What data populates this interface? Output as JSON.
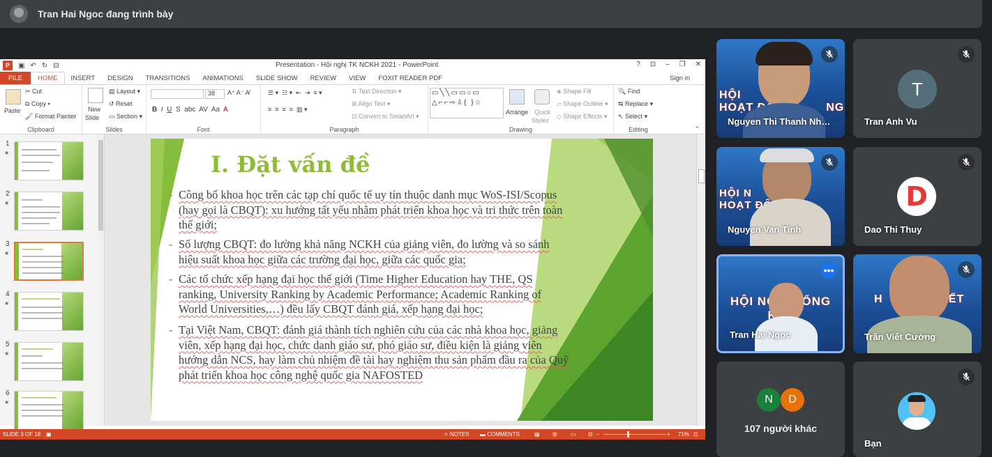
{
  "meet": {
    "presenter_title": "Tran Hai Ngoc đang trình bày",
    "participants": [
      {
        "name": "Nguyen Thi Thanh Nh…",
        "muted": true,
        "type": "video"
      },
      {
        "name": "Tran Anh Vu",
        "muted": true,
        "type": "letter",
        "letter": "T"
      },
      {
        "name": "Nguyen Van Tinh",
        "muted": true,
        "type": "video"
      },
      {
        "name": "Dao Thi Thuy",
        "muted": true,
        "type": "logo",
        "letter": "D"
      },
      {
        "name": "Tran Hai Ngoc",
        "muted": false,
        "type": "video",
        "active": true
      },
      {
        "name": "Trần Viết Cường",
        "muted": true,
        "type": "video"
      },
      {
        "name": "107 người khác",
        "type": "others",
        "letters": [
          "N",
          "D"
        ]
      },
      {
        "name": "Bạn",
        "muted": true,
        "type": "self"
      }
    ],
    "video_banner": "HỘI NGHỊ TỔNG KẾT",
    "colors": {
      "bg": "#202124",
      "tile": "#3c4043",
      "accent": "#8ab4f8",
      "avatar_n": "#188038",
      "avatar_d": "#e8710a"
    }
  },
  "ppt": {
    "window_title": "Presentation - Hội nghị TK NCKH 2021 - PowerPoint",
    "tabs": [
      "FILE",
      "HOME",
      "INSERT",
      "DESIGN",
      "TRANSITIONS",
      "ANIMATIONS",
      "SLIDE SHOW",
      "REVIEW",
      "VIEW",
      "FOXIT READER PDF"
    ],
    "active_tab": "HOME",
    "sign_in": "Sign in",
    "ribbon": {
      "clipboard": {
        "label": "Clipboard",
        "paste": "Paste",
        "cut": "Cut",
        "copy": "Copy",
        "format_painter": "Format Painter"
      },
      "slides": {
        "label": "Slides",
        "new_slide_1": "New",
        "new_slide_2": "Slide",
        "layout": "Layout",
        "reset": "Reset",
        "section": "Section"
      },
      "font": {
        "label": "Font",
        "size": "38"
      },
      "paragraph": {
        "label": "Paragraph",
        "text_direction": "Text Direction",
        "align_text": "Align Text",
        "convert": "Convert to SmartArt"
      },
      "drawing": {
        "label": "Drawing",
        "arrange": "Arrange",
        "quick_styles_1": "Quick",
        "quick_styles_2": "Styles",
        "shape_fill": "Shape Fill",
        "shape_outline": "Shape Outline",
        "shape_effects": "Shape Effects"
      },
      "editing": {
        "label": "Editing",
        "find": "Find",
        "replace": "Replace",
        "select": "Select"
      }
    },
    "thumbnails": [
      "1",
      "2",
      "3",
      "4",
      "5",
      "6"
    ],
    "selected_slide": "3",
    "slide": {
      "title": "I. Đặt vấn đề",
      "bullets": [
        "Công bố khoa học trên các tạp chí quốc tế uy tín thuộc danh mục WoS-ISI/Scopus (hay gọi là CBQT): xu hướng tất yếu nhằm phát triển khoa học và tri thức trên toàn thế giới;",
        "Số lượng CBQT: đo lường khả năng NCKH của giảng viên, đo lường và so sánh hiệu suất khoa học giữa các trường đại học, giữa các quốc gia;",
        "Các tổ chức xếp hạng đại học thế giới (Time Higher Education hay THE, QS ranking, University Ranking by Academic Performance; Academic Ranking of World Universities,…) đều lấy CBQT đánh giá, xếp hạng đại học;",
        "Tại Việt Nam, CBQT: đánh giá thành tích nghiên cứu của các nhà khoa học, giảng viên, xếp hạng đại học, chức danh giáo sư, phó giáo sư, điều kiện là giảng viên hướng dẫn NCS, hay làm chủ nhiệm đề tài hay nghiệm thu sản phẩm đầu ra của Quỹ phát triển khoa học công nghệ quốc gia NAFOSTED"
      ]
    },
    "status": {
      "slide": "SLIDE 3 OF 18",
      "notes": "NOTES",
      "comments": "COMMENTS",
      "zoom": "71%"
    },
    "colors": {
      "accent": "#d24726",
      "title_green": "#8fbc35"
    }
  }
}
